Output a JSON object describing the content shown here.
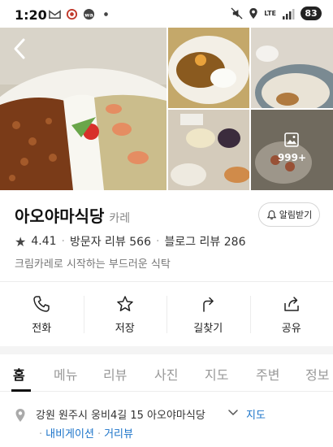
{
  "status_bar": {
    "time": "1:20",
    "lte": "LTE",
    "battery": "83"
  },
  "gallery": {
    "more_count": "999+",
    "avatar_text": "my"
  },
  "place": {
    "name": "아오야마식당",
    "category": "카레",
    "notify_label": "알림받기",
    "rating": "4.41",
    "visitor_reviews": "방문자 리뷰 566",
    "blog_reviews": "블로그 리뷰 286",
    "description": "크림카레로 시작하는 부드러운 식탁"
  },
  "actions": [
    {
      "label": "전화",
      "icon": "phone-icon"
    },
    {
      "label": "저장",
      "icon": "star-icon"
    },
    {
      "label": "길찾기",
      "icon": "directions-icon"
    },
    {
      "label": "공유",
      "icon": "share-icon"
    }
  ],
  "tabs": [
    "홈",
    "메뉴",
    "리뷰",
    "사진",
    "지도",
    "주변",
    "정보"
  ],
  "address": {
    "text": "강원 원주시 웅비4길 15 아오야마식당",
    "map_link": "지도",
    "navigation": "내비게이션",
    "street_view": "거리뷰"
  },
  "colors": {
    "link": "#1a73c9",
    "text": "#111111",
    "muted": "#888888"
  }
}
